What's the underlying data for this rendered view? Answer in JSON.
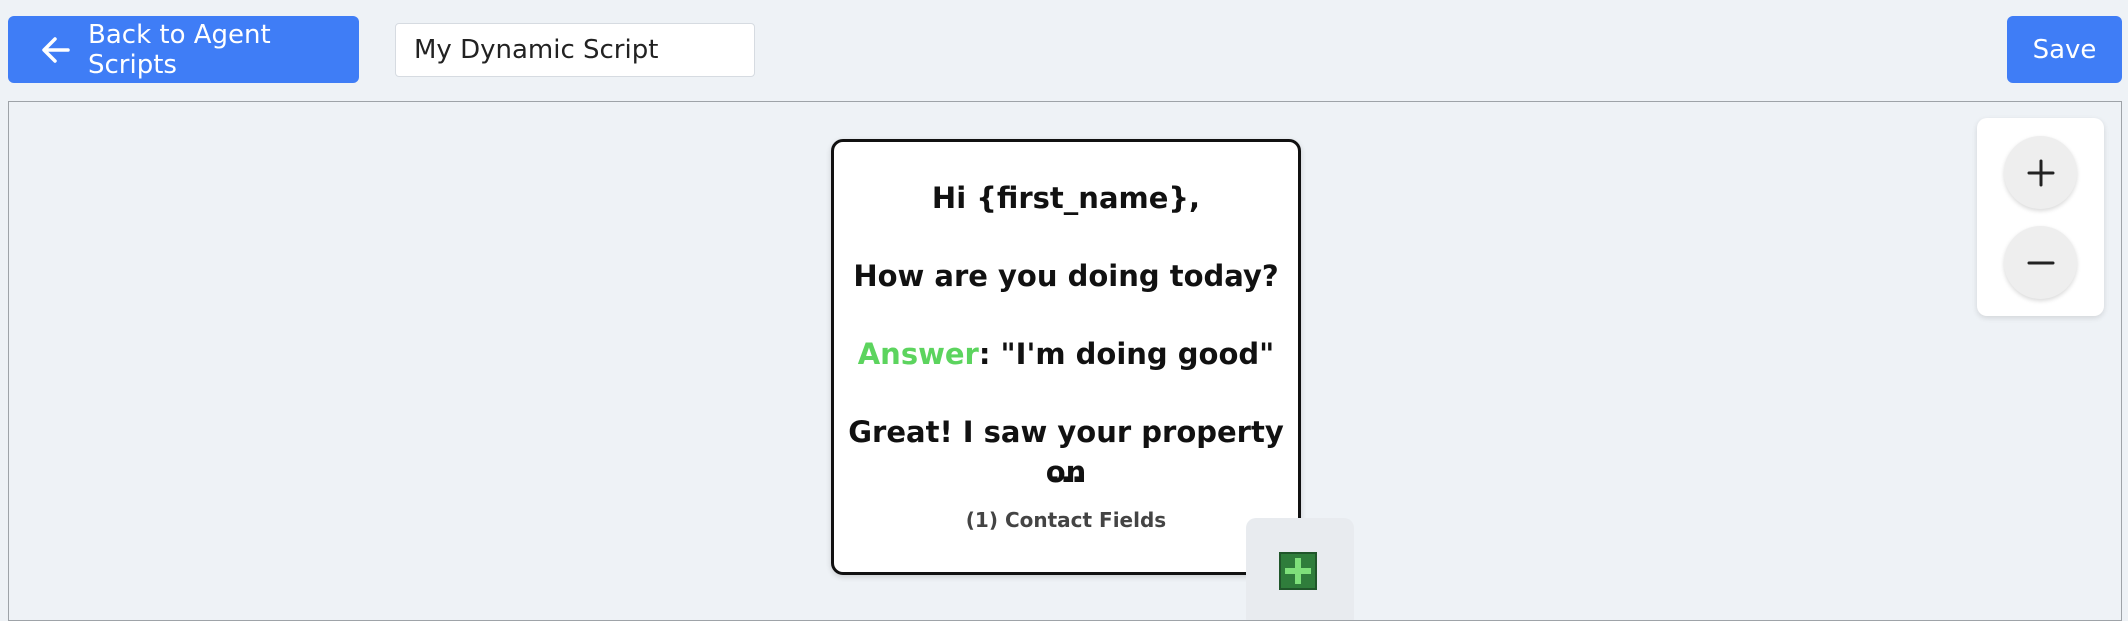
{
  "header": {
    "back_label": "Back to Agent Scripts",
    "script_name": "My Dynamic Script",
    "save_label": "Save"
  },
  "node": {
    "greeting": "Hi {first_name},",
    "question": "How are you doing today?",
    "answer_label": "Answer",
    "answer_text": ": \"I'm doing good\"",
    "response_line1": "Great! I saw your property on",
    "response_line2": "...",
    "contact_fields": "(1) Contact Fields"
  },
  "icons": {
    "back": "arrow-left-icon",
    "zoom_in": "plus-icon",
    "zoom_out": "minus-icon",
    "add_node": "plus-icon"
  },
  "colors": {
    "primary": "#3f7df6",
    "answer": "#5cd45e",
    "add_node": "#2f7d3b"
  }
}
